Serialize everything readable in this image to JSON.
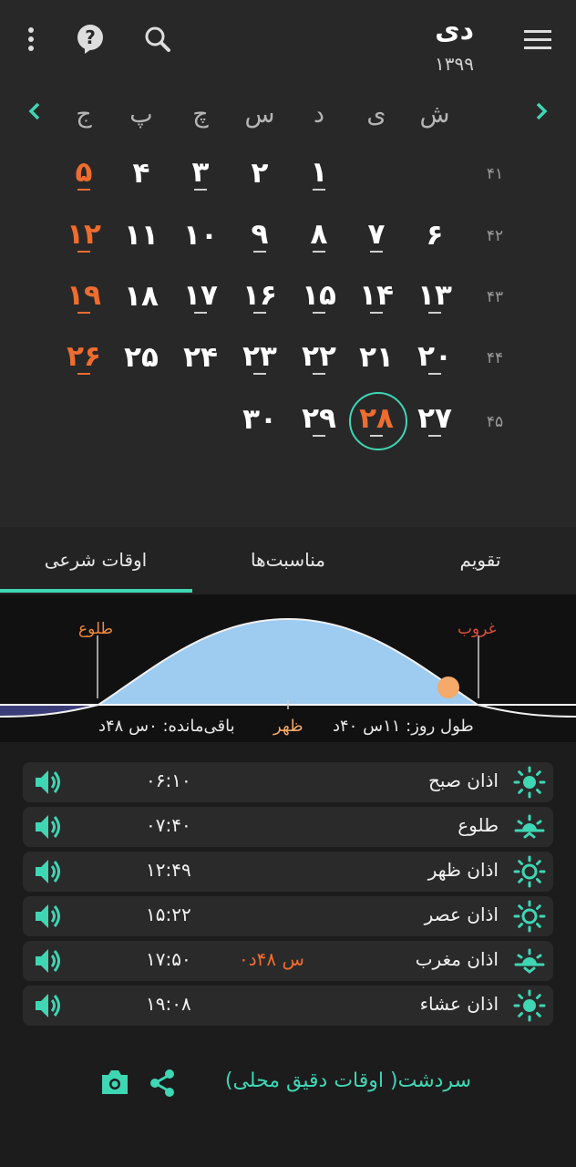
{
  "header": {
    "month": "دی",
    "year": "۱۳۹۹"
  },
  "weekdays": [
    "ش",
    "ی",
    "د",
    "س",
    "چ",
    "پ",
    "ج"
  ],
  "weeks": [
    {
      "num": "۴۱",
      "days": [
        "",
        "",
        "",
        "۱",
        "۲",
        "۳",
        "۵"
      ]
    },
    {
      "num": "۴۲",
      "days": [
        "۶",
        "۷",
        "۸",
        "۹",
        "۱۰",
        "۱۱",
        "۱۲"
      ]
    },
    {
      "num": "۴۳",
      "days": [
        "۱۳",
        "۱۴",
        "۱۵",
        "۱۶",
        "۱۷",
        "۱۸",
        "۱۹"
      ]
    },
    {
      "num": "۴۴",
      "days": [
        "۲۰",
        "۲۱",
        "۲۲",
        "۲۳",
        "۲۴",
        "۲۵",
        "۲۶"
      ]
    },
    {
      "num": "۴۵",
      "days": [
        "۲۷",
        "۲۸",
        "۲۹",
        "۳۰",
        "",
        "",
        ""
      ]
    }
  ],
  "week1_day5": "۴",
  "today": "۲۸",
  "tabs": {
    "calendar": "تقویم",
    "events": "مناسبت‌ها",
    "owghat": "اوقات شرعی"
  },
  "graph": {
    "sunrise": "طلوع",
    "sunset": "غروب",
    "noon": "ظهر",
    "day_length": "طول روز: ۱۱س ۴۰د",
    "remaining": "باقی‌مانده: ۰س ۴۸د"
  },
  "prayers": [
    {
      "name": "اذان صبح",
      "time": "۰۶:۱۰",
      "remaining": ""
    },
    {
      "name": "طلوع",
      "time": "۰۷:۴۰",
      "remaining": ""
    },
    {
      "name": "اذان ظهر",
      "time": "۱۲:۴۹",
      "remaining": ""
    },
    {
      "name": "اذان عصر",
      "time": "۱۵:۲۲",
      "remaining": ""
    },
    {
      "name": "اذان مغرب",
      "time": "۱۷:۵۰",
      "remaining": "۰س ۴۸د"
    },
    {
      "name": "اذان عشاء",
      "time": "۱۹:۰۸",
      "remaining": ""
    }
  ],
  "footer": {
    "location": "سردشت( اوقات دقیق محلی)"
  },
  "colors": {
    "accent": "#3fd6b4",
    "holiday": "#ef6c2f",
    "sun": "#f5a96a",
    "sky": "#9ecbf0"
  }
}
